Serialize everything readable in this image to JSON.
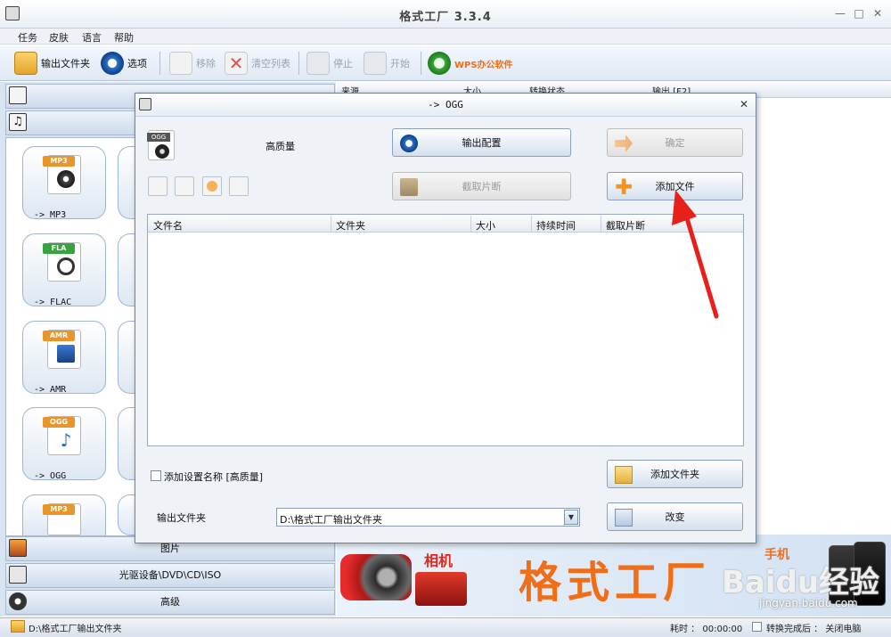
{
  "window": {
    "title": "格式工厂  3.3.4"
  },
  "menu": [
    "任务",
    "皮肤",
    "语言",
    "帮助"
  ],
  "toolbar": {
    "output_folder": "输出文件夹",
    "options": "选项",
    "remove": "移除",
    "clear_list": "清空列表",
    "stop": "停止",
    "start": "开始",
    "wps": "WPS办公软件"
  },
  "categories": {
    "pictures": "图片",
    "optical": "光驱设备\\DVD\\CD\\ISO",
    "advanced": "高级"
  },
  "formats": [
    {
      "tag": "MP3",
      "label": "-> MP3",
      "color": "#e8962b"
    },
    {
      "tag": "FLA",
      "label": "-> FLAC",
      "color": "#3aa341"
    },
    {
      "tag": "AMR",
      "label": "-> AMR",
      "color": "#e8962b"
    },
    {
      "tag": "OGG",
      "label": "-> OGG",
      "color": "#e8962b"
    },
    {
      "tag": "MP3",
      "label": "",
      "color": "#e8962b"
    }
  ],
  "task_list": {
    "columns": [
      "来源",
      "大小",
      "转换状态",
      "输出 [F2]"
    ]
  },
  "banner": {
    "brand": "格式工厂",
    "camera": "相机",
    "phone": "手机"
  },
  "statusbar": {
    "output_path": "D:\\格式工厂输出文件夹",
    "elapsed_label": "耗时 ： 00:00:00",
    "after_done": "转换完成后 ： 关闭电脑"
  },
  "dialog": {
    "title": "-> OGG",
    "format_tag": "OGG",
    "quality": "高质量",
    "output_config": "输出配置",
    "ok": "确定",
    "clip": "截取片断",
    "add_file": "添加文件",
    "columns": [
      "文件名",
      "文件夹",
      "大小",
      "持续时间",
      "截取片断"
    ],
    "add_setting_name": "添加设置名称 [高质量]",
    "add_folder": "添加文件夹",
    "output_folder_label": "输出文件夹",
    "output_folder_value": "D:\\格式工厂输出文件夹",
    "change": "改变"
  },
  "colors": {
    "accent_orange": "#f06e17",
    "arrow_red": "#e8201a"
  },
  "watermark": {
    "text": "Baidu经验",
    "url": "jingyan.baidu.com"
  }
}
